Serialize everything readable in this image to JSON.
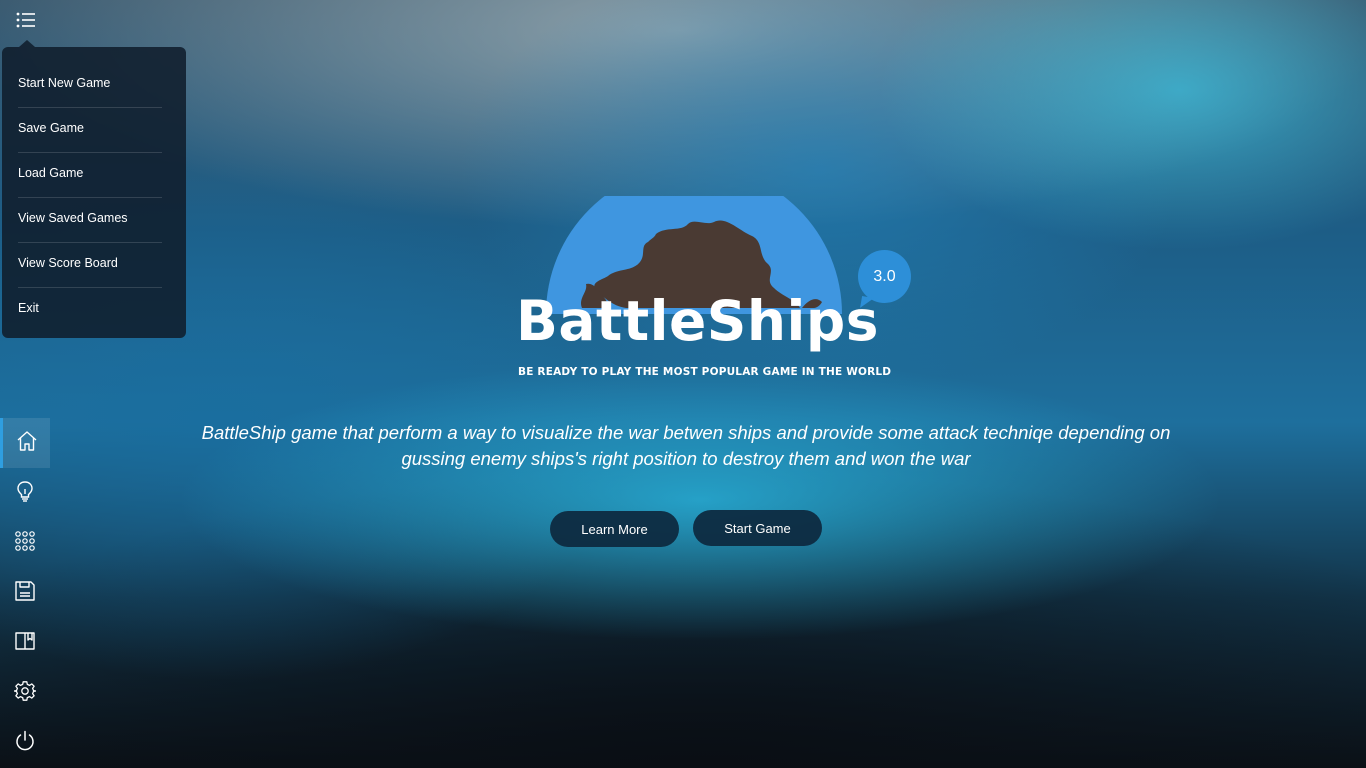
{
  "header": {
    "menu_icon": "list-icon"
  },
  "menu": {
    "items": [
      {
        "label": "Start New Game"
      },
      {
        "label": "Save Game"
      },
      {
        "label": "Load Game"
      },
      {
        "label": "View Saved Games"
      },
      {
        "label": "View Score Board"
      },
      {
        "label": "Exit"
      }
    ]
  },
  "sidebar": {
    "items": [
      {
        "icon": "home-icon",
        "active": true
      },
      {
        "icon": "lightbulb-icon",
        "active": false
      },
      {
        "icon": "grid-icon",
        "active": false
      },
      {
        "icon": "save-icon",
        "active": false
      },
      {
        "icon": "book-icon",
        "active": false
      },
      {
        "icon": "gear-icon",
        "active": false
      },
      {
        "icon": "power-icon",
        "active": false
      }
    ]
  },
  "logo": {
    "wordmark": "BattleShips",
    "tagline": "BE READY TO PLAY THE MOST POPULAR GAME IN THE WORLD",
    "version": "3.0"
  },
  "main": {
    "description": "BattleShip game that perform a way to visualize the war betwen ships and provide some attack techniqe depending on gussing enemy ships's right position to destroy them and won the war",
    "learn_more_label": "Learn More",
    "start_game_label": "Start Game"
  },
  "colors": {
    "accent": "#2d8fd8",
    "button_bg": "#0d283e",
    "menu_bg": "#101e2c"
  }
}
